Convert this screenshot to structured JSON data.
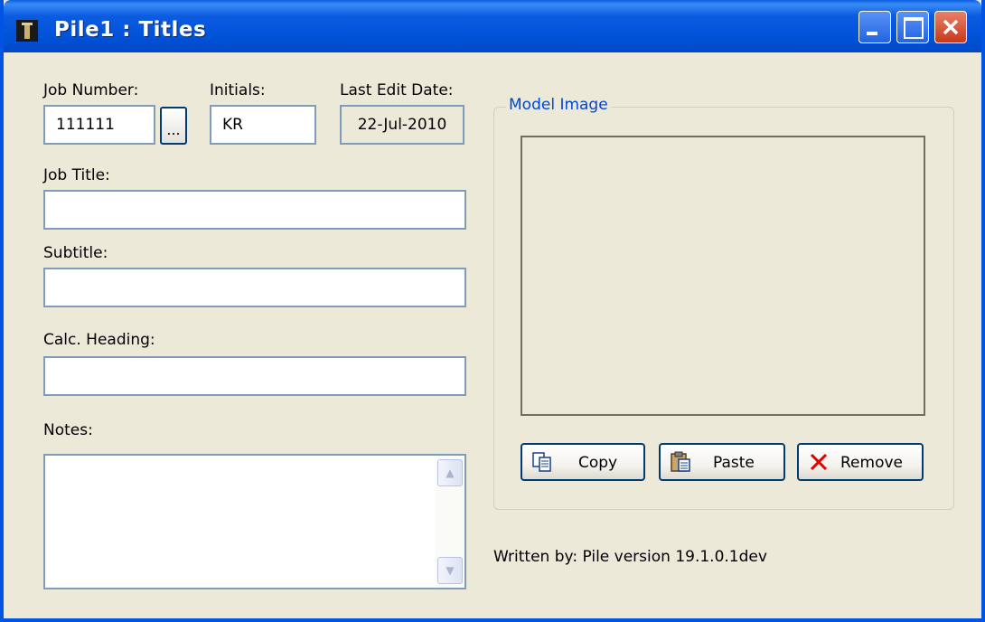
{
  "window": {
    "title": "Pile1 : Titles"
  },
  "fields": {
    "job_number": {
      "label": "Job Number:",
      "value": "111111",
      "browse_label": "..."
    },
    "initials": {
      "label": "Initials:",
      "value": "KR"
    },
    "last_edit_date": {
      "label": "Last Edit Date:",
      "value": "22-Jul-2010"
    },
    "job_title": {
      "label": "Job Title:",
      "value": ""
    },
    "subtitle": {
      "label": "Subtitle:",
      "value": ""
    },
    "calc_heading": {
      "label": "Calc. Heading:",
      "value": ""
    },
    "notes": {
      "label": "Notes:",
      "value": ""
    }
  },
  "model_image": {
    "legend": "Model Image",
    "buttons": {
      "copy": "Copy",
      "paste": "Paste",
      "remove": "Remove"
    }
  },
  "footer": {
    "written_by": "Written by: Pile version 19.1.0.1dev"
  },
  "icons": [
    "app-icon",
    "minimize-icon",
    "maximize-icon",
    "close-icon",
    "scroll-up-icon",
    "scroll-down-icon",
    "copy-icon",
    "paste-icon",
    "remove-icon"
  ],
  "colors": {
    "titlebar": "#0054e3",
    "face": "#ece9d8",
    "legend": "#0046d5",
    "field_border": "#7f9db9",
    "remove": "#e00000"
  }
}
